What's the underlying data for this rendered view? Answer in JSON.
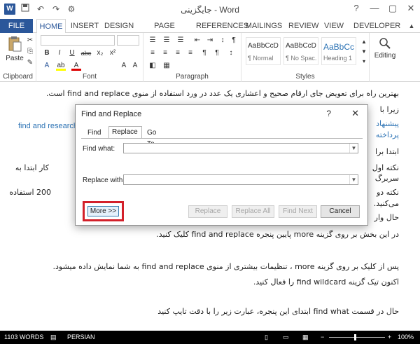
{
  "window": {
    "title": "جایگزینی - Word",
    "controls": [
      "?",
      "—",
      "▢",
      "✕"
    ]
  },
  "quick_access": [
    "W",
    "💾",
    "↶",
    "↷",
    "⚙"
  ],
  "tabs": [
    {
      "label": "FILE"
    },
    {
      "label": "HOME"
    },
    {
      "label": "INSERT"
    },
    {
      "label": "DESIGN"
    },
    {
      "label": "PAGE LAYOUT"
    },
    {
      "label": "REFERENCES"
    },
    {
      "label": "MAILINGS"
    },
    {
      "label": "REVIEW"
    },
    {
      "label": "VIEW"
    },
    {
      "label": "DEVELOPER"
    }
  ],
  "ribbon": {
    "clipboard": {
      "label": "Clipboard",
      "paste": "Paste"
    },
    "font": {
      "label": "Font",
      "bold": "B",
      "italic": "I",
      "underline": "U",
      "strike": "abc",
      "sub": "x₂",
      "sup": "x²",
      "clear": "A"
    },
    "paragraph": {
      "label": "Paragraph"
    },
    "styles": {
      "label": "Styles",
      "items": [
        {
          "preview": "AaBbCcDc",
          "name": "¶ Normal"
        },
        {
          "preview": "AaBbCcDc",
          "name": "¶ No Spac..."
        },
        {
          "preview": "AaBbCc",
          "name": "Heading 1"
        }
      ]
    },
    "editing": {
      "label": "Editing"
    }
  },
  "document": {
    "lines": [
      "بهترین راه برای تعویض جای ارقام صحیح و اعشاری یک عدد در ورد استفاده از منوی find and replace است.",
      "زیرا با",
      "پیشنهاد",
      "پرداخته",
      "ابتدا برا",
      "نکته اول",
      "سربرگ",
      "نکته دو",
      "می‌کنید.",
      "حال وار",
      "در این بخش بر روی گزینه more  پایین پنجره find and replace کلیک کنید.",
      "پس از کلیک بر روی گزینه more ، تنظیمات بیشتری از منوی find and replace به شما نمایش داده میشود.",
      "اکنون تیک گزینه find wildcard را فعال کنید.",
      "حال در قسمت find what ابتدای این پنجره، عبارت زیر را با دقت تایپ کنید"
    ],
    "fragments": {
      "find_research": "find and research",
      "line6_end": "کار ابتدا به",
      "line8_end": "200 استفاده"
    }
  },
  "dialog": {
    "title": "Find and Replace",
    "help": "?",
    "close": "✕",
    "tabs": [
      "Find",
      "Replace",
      "Go To"
    ],
    "find_what_label": "Find what:",
    "find_what_value": "",
    "replace_with_label": "Replace with:",
    "replace_with_value": "",
    "buttons": {
      "more": "More >>",
      "replace": "Replace",
      "replace_all": "Replace All",
      "find_next": "Find Next",
      "cancel": "Cancel"
    },
    "highlight_color": "#d3202a"
  },
  "status": {
    "words": "1103 WORDS",
    "language": "PERSIAN",
    "zoom": "100%",
    "zoom_minus": "−",
    "zoom_plus": "+"
  },
  "colors": {
    "accent": "#2b579a",
    "link": "#2e74b5"
  }
}
